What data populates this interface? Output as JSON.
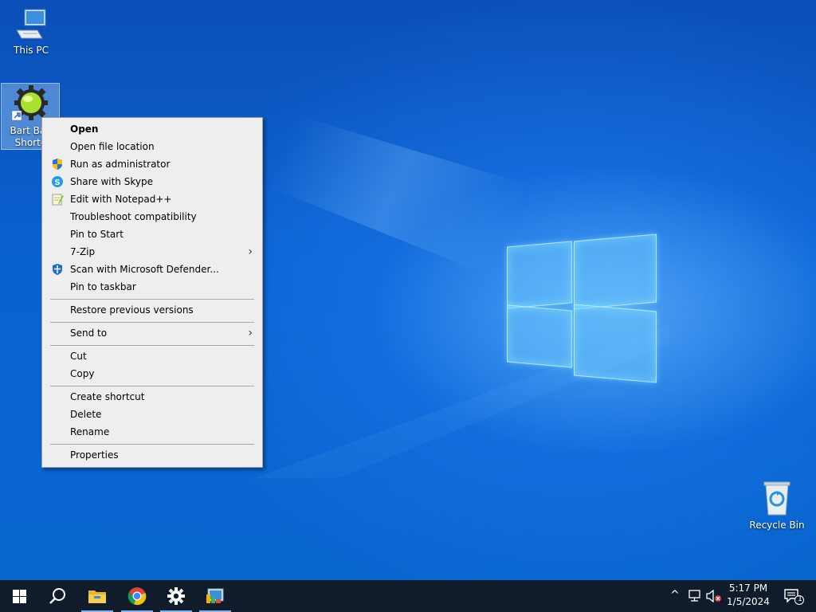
{
  "desktop": {
    "icons": [
      {
        "name": "this-pc",
        "label": "This PC"
      },
      {
        "name": "bart-basic-shortcut",
        "label": "Bart Basic Shortcut",
        "label_line1": "Bart Bas",
        "label_line2": "Shortc"
      },
      {
        "name": "recycle-bin",
        "label": "Recycle Bin"
      }
    ]
  },
  "context_menu": {
    "items": [
      {
        "label": "Open",
        "bold": true
      },
      {
        "label": "Open file location"
      },
      {
        "label": "Run as administrator",
        "icon": "shield-icon"
      },
      {
        "label": "Share with Skype",
        "icon": "skype-icon"
      },
      {
        "label": "Edit with Notepad++",
        "icon": "notepadpp-icon"
      },
      {
        "label": "Troubleshoot compatibility"
      },
      {
        "label": "Pin to Start"
      },
      {
        "label": "7-Zip",
        "submenu": true
      },
      {
        "label": "Scan with Microsoft Defender...",
        "icon": "defender-icon"
      },
      {
        "label": "Pin to taskbar"
      },
      {
        "label": "Restore previous versions"
      },
      {
        "label": "Send to",
        "submenu": true
      },
      {
        "label": "Cut"
      },
      {
        "label": "Copy"
      },
      {
        "label": "Create shortcut"
      },
      {
        "label": "Delete"
      },
      {
        "label": "Rename"
      },
      {
        "label": "Properties"
      }
    ],
    "submenu_arrow": "›"
  },
  "taskbar": {
    "buttons": [
      "start-icon",
      "search-icon",
      "file-explorer-icon",
      "chrome-icon",
      "settings-icon",
      "control-panel-icon"
    ],
    "tray": {
      "chevron": "^",
      "icons": [
        "network-icon",
        "volume-muted-icon"
      ],
      "time": "5:17 PM",
      "date": "1/5/2024",
      "notification_count": "1"
    }
  },
  "colors": {
    "accent": "#0a5fc4",
    "taskbar": "#101b2b",
    "menu_bg": "#eeeeee"
  }
}
